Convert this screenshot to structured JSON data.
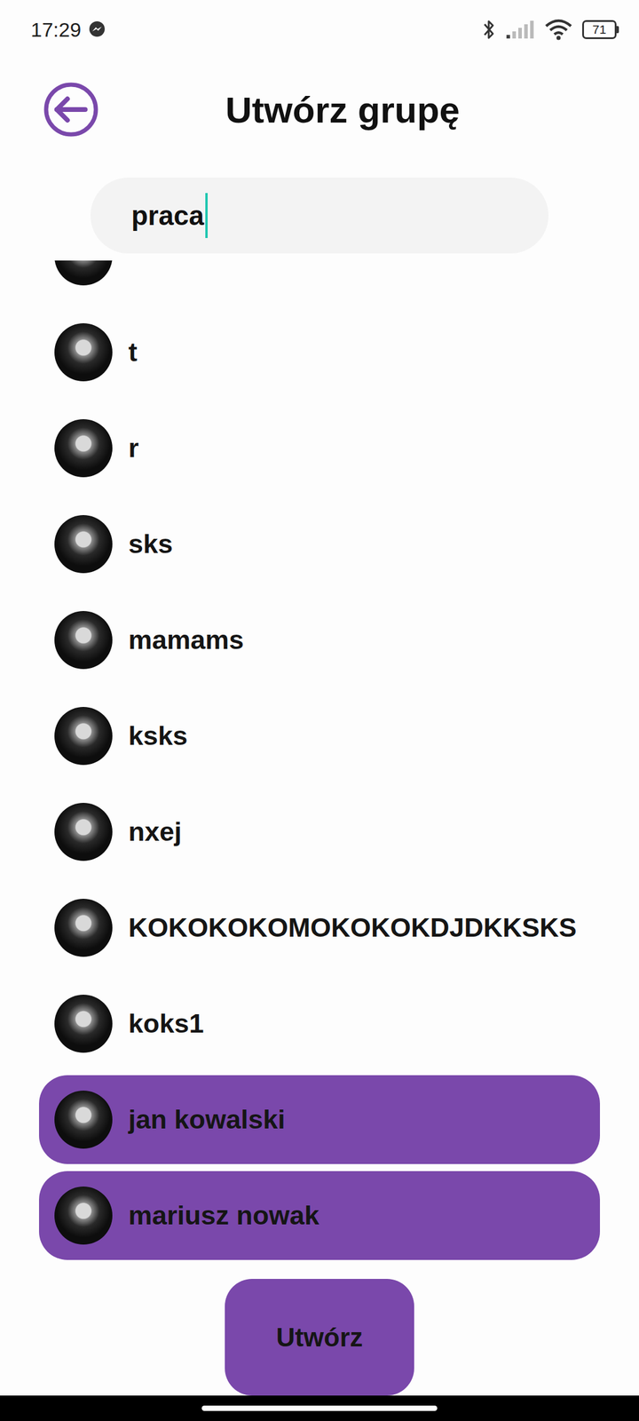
{
  "status_bar": {
    "time": "17:29",
    "battery": "71"
  },
  "header": {
    "title": "Utwórz grupę"
  },
  "search": {
    "value": "praca"
  },
  "contacts": [
    {
      "name": "t",
      "selected": false
    },
    {
      "name": "r",
      "selected": false
    },
    {
      "name": "sks",
      "selected": false
    },
    {
      "name": "mamams",
      "selected": false
    },
    {
      "name": "ksks",
      "selected": false
    },
    {
      "name": "nxej",
      "selected": false
    },
    {
      "name": "KOKOKOKOMOKOKOKDJDKKSKS",
      "selected": false
    },
    {
      "name": "koks1",
      "selected": false
    },
    {
      "name": "jan kowalski",
      "selected": true
    },
    {
      "name": "mariusz nowak",
      "selected": true
    }
  ],
  "button": {
    "label": "Utwórz"
  }
}
